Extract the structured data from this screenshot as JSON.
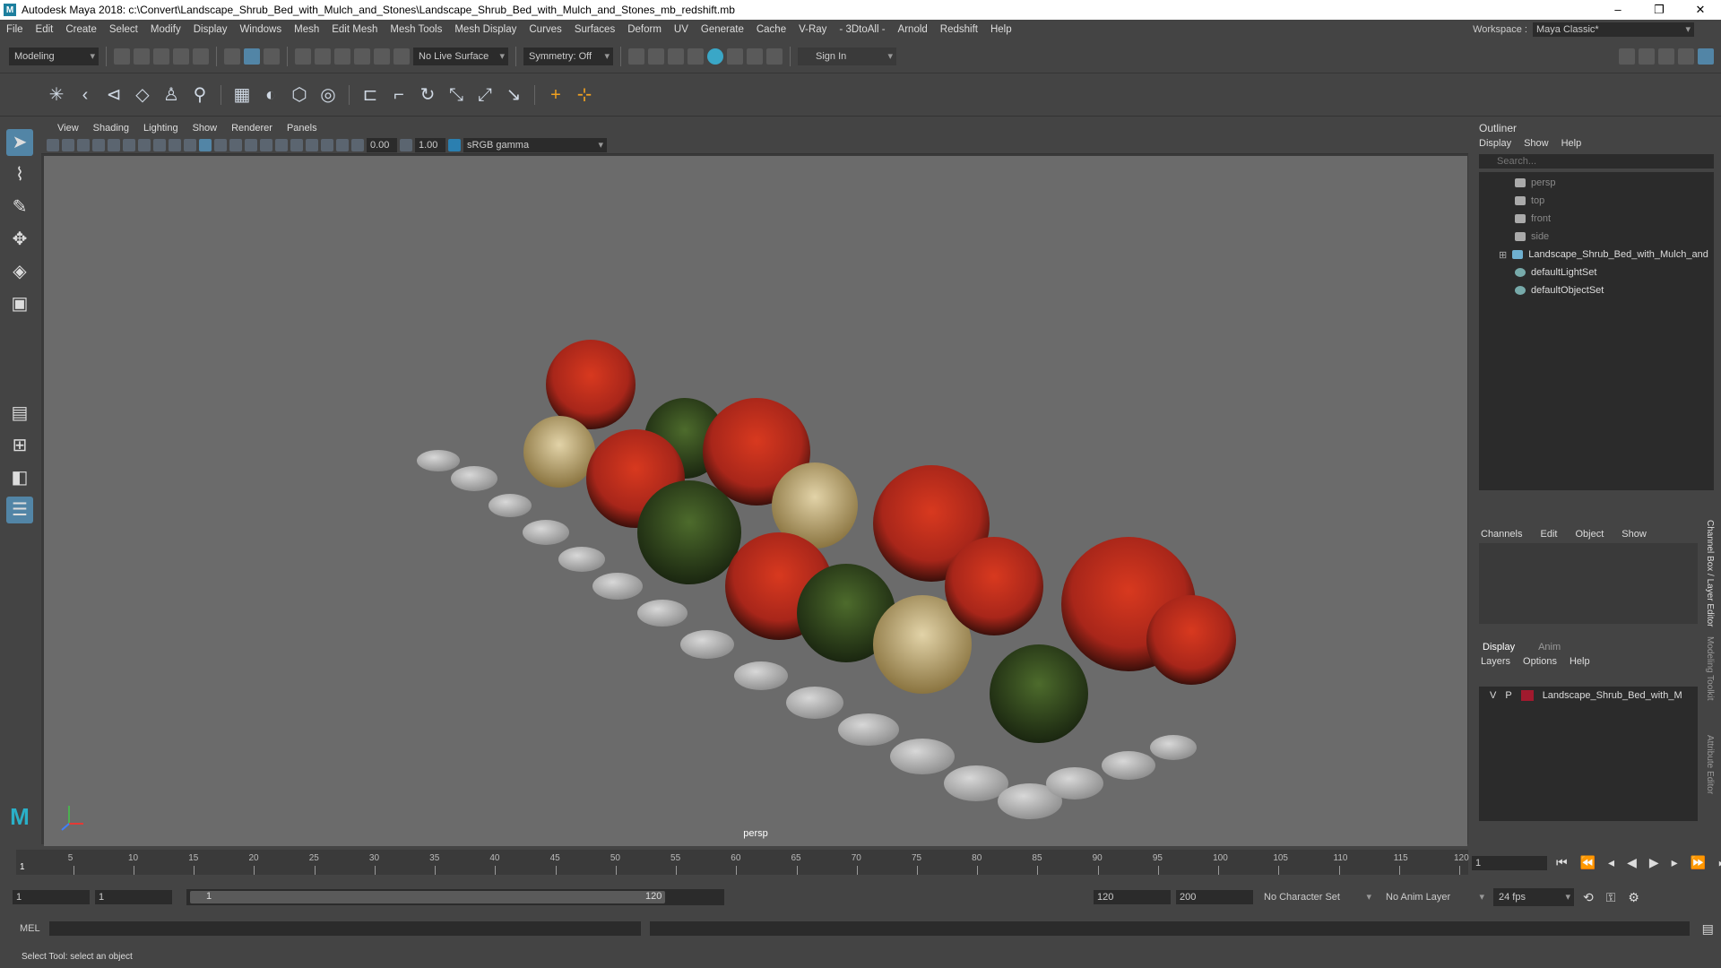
{
  "window": {
    "title": "Autodesk Maya 2018: c:\\Convert\\Landscape_Shrub_Bed_with_Mulch_and_Stones\\Landscape_Shrub_Bed_with_Mulch_and_Stones_mb_redshift.mb",
    "minimize": "–",
    "maximize": "❐",
    "close": "✕"
  },
  "menu": {
    "items": [
      "File",
      "Edit",
      "Create",
      "Select",
      "Modify",
      "Display",
      "Windows",
      "Mesh",
      "Edit Mesh",
      "Mesh Tools",
      "Mesh Display",
      "Curves",
      "Surfaces",
      "Deform",
      "UV",
      "Generate",
      "Cache",
      "V-Ray",
      "- 3DtoAll -",
      "Arnold",
      "Redshift",
      "Help"
    ],
    "workspace_label": "Workspace :",
    "workspace_value": "Maya Classic*"
  },
  "status": {
    "mode": "Modeling",
    "live_surface": "No Live Surface",
    "symmetry": "Symmetry: Off",
    "sign_in": "Sign In"
  },
  "viewport": {
    "menu": [
      "View",
      "Shading",
      "Lighting",
      "Show",
      "Renderer",
      "Panels"
    ],
    "exposure": "0.00",
    "gamma": "1.00",
    "color_space": "sRGB gamma",
    "camera": "persp"
  },
  "outliner": {
    "title": "Outliner",
    "menu": [
      "Display",
      "Show",
      "Help"
    ],
    "search_placeholder": "Search...",
    "items": [
      {
        "label": "persp",
        "dim": true
      },
      {
        "label": "top",
        "dim": true
      },
      {
        "label": "front",
        "dim": true
      },
      {
        "label": "side",
        "dim": true
      },
      {
        "label": "Landscape_Shrub_Bed_with_Mulch_and",
        "dim": false
      },
      {
        "label": "defaultLightSet",
        "dim": false
      },
      {
        "label": "defaultObjectSet",
        "dim": false
      }
    ]
  },
  "channel_box": {
    "menu": [
      "Channels",
      "Edit",
      "Object",
      "Show"
    ]
  },
  "layer_editor": {
    "tabs": [
      "Display",
      "Anim"
    ],
    "menu": [
      "Layers",
      "Options",
      "Help"
    ],
    "layer": {
      "v": "V",
      "p": "P",
      "name": "Landscape_Shrub_Bed_with_M"
    }
  },
  "side_tabs": [
    "Channel Box / Layer Editor",
    "Modeling Toolkit",
    "Attribute Editor"
  ],
  "timeline": {
    "ticks": [
      "5",
      "10",
      "15",
      "20",
      "25",
      "30",
      "35",
      "40",
      "45",
      "50",
      "55",
      "60",
      "65",
      "70",
      "75",
      "80",
      "85",
      "90",
      "95",
      "100",
      "105",
      "110",
      "115",
      "120"
    ],
    "start_marker": "1",
    "current_frame": "1"
  },
  "range": {
    "start": "1",
    "playback_start": "1",
    "slider_start": "1",
    "slider_end": "120",
    "playback_end": "120",
    "end": "200",
    "character_set": "No Character Set",
    "anim_layer": "No Anim Layer",
    "fps": "24 fps"
  },
  "mel": {
    "label": "MEL"
  },
  "help_line": "Select Tool: select an object"
}
